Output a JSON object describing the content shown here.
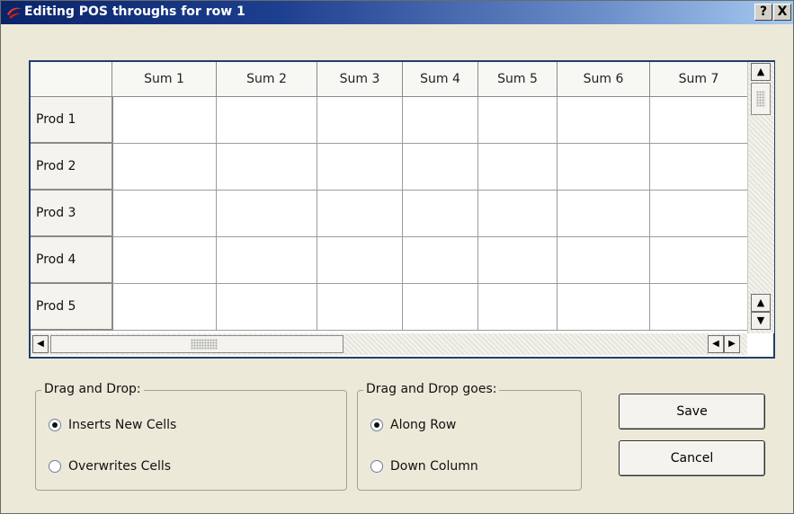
{
  "window": {
    "title": "Editing POS throughs for row 1",
    "help_label": "?",
    "close_label": "X",
    "logo_icon": "red-swoosh-icon"
  },
  "grid": {
    "columns": [
      "Sum 1",
      "Sum 2",
      "Sum 3",
      "Sum 4",
      "Sum 5",
      "Sum 6",
      "Sum 7"
    ],
    "rows": [
      "Prod 1",
      "Prod 2",
      "Prod 3",
      "Prod 4",
      "Prod 5"
    ],
    "cells": [
      [
        "",
        "",
        "",
        "",
        "",
        "",
        ""
      ],
      [
        "",
        "",
        "",
        "",
        "",
        "",
        ""
      ],
      [
        "",
        "",
        "",
        "",
        "",
        "",
        ""
      ],
      [
        "",
        "",
        "",
        "",
        "",
        "",
        ""
      ],
      [
        "",
        "",
        "",
        "",
        "",
        "",
        ""
      ]
    ]
  },
  "scrollbars": {
    "up_glyph": "▲",
    "down_glyph": "▼",
    "left_glyph": "◀",
    "right_glyph": "▶"
  },
  "drag_drop": {
    "legend": "Drag and Drop:",
    "options": [
      "Inserts New Cells",
      "Overwrites Cells"
    ],
    "selected": 0
  },
  "drag_drop_goes": {
    "legend": "Drag and Drop goes:",
    "options": [
      "Along Row",
      "Down Column"
    ],
    "selected": 0
  },
  "buttons": {
    "save": "Save",
    "cancel": "Cancel"
  },
  "colors": {
    "titlebar_start": "#0a246a",
    "titlebar_end": "#a6caf0",
    "grid_border": "#1d3f6e",
    "dialog_bg": "#ece9d8"
  }
}
